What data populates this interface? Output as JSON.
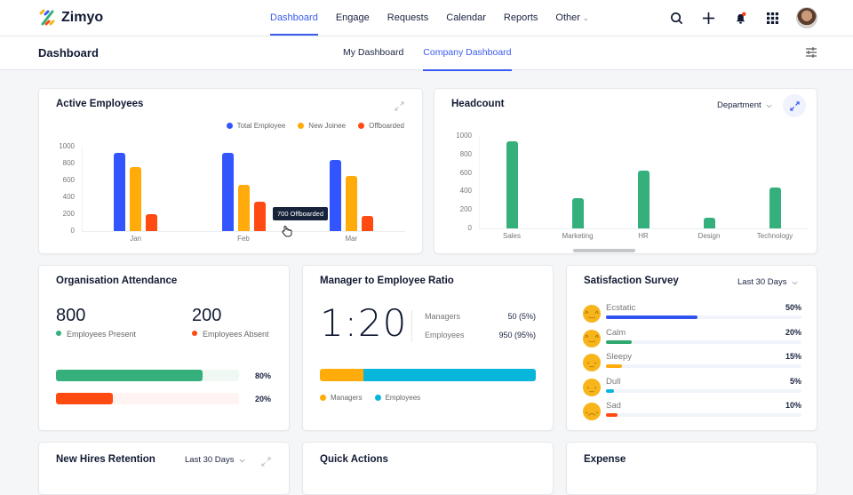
{
  "app": {
    "name": "Zimyo"
  },
  "nav": {
    "items": [
      {
        "label": "Dashboard",
        "active": true
      },
      {
        "label": "Engage"
      },
      {
        "label": "Requests"
      },
      {
        "label": "Calendar"
      },
      {
        "label": "Reports"
      },
      {
        "label": "Other",
        "has_dropdown": true
      }
    ],
    "icons": [
      "search-icon",
      "plus-icon",
      "bell-icon",
      "apps-grid-icon",
      "avatar"
    ]
  },
  "subheader": {
    "title": "Dashboard",
    "tabs": [
      {
        "label": "My Dashboard"
      },
      {
        "label": "Company Dashboard",
        "active": true
      }
    ]
  },
  "colors": {
    "accent": "#3a5bf0",
    "total_employee": "#3355ff",
    "new_joinee": "#ffab0a",
    "offboarded": "#ff4a12",
    "green": "#35b07c",
    "cyan": "#08b6dc"
  },
  "active_employees": {
    "title": "Active Employees",
    "tooltip": "700 Offboarded"
  },
  "headcount": {
    "title": "Headcount",
    "dropdown": "Department"
  },
  "chart_data": [
    {
      "type": "bar",
      "title": "Active Employees",
      "categories": [
        "Jan",
        "Feb",
        "Mar"
      ],
      "series": [
        {
          "name": "Total Employee",
          "values": [
            930,
            930,
            840
          ],
          "color": "#3355ff"
        },
        {
          "name": "New Joinee",
          "values": [
            760,
            545,
            650
          ],
          "color": "#ffab0a"
        },
        {
          "name": "Offboarded",
          "values": [
            200,
            350,
            175
          ],
          "color": "#ff4a12"
        }
      ],
      "yticks": [
        "0",
        "200",
        "400",
        "600",
        "800",
        "1000"
      ],
      "ylim": [
        0,
        1000
      ],
      "legend": "top-right",
      "xlabel": "",
      "ylabel": ""
    },
    {
      "type": "bar",
      "title": "Headcount",
      "categories": [
        "Sales",
        "Marketing",
        "HR",
        "Design",
        "Technology"
      ],
      "values": [
        942,
        327,
        622,
        112,
        445
      ],
      "color": "#35b07c",
      "yticks": [
        "0",
        "200",
        "400",
        "600",
        "800",
        "1000"
      ],
      "ylim": [
        0,
        1000
      ],
      "xlabel": "",
      "ylabel": ""
    }
  ],
  "attendance": {
    "title": "Organisation Attendance",
    "present_value": "800",
    "present_label": "Employees Present",
    "absent_value": "200",
    "absent_label": "Employees Absent",
    "present_pct": "80%",
    "absent_pct": "20%",
    "present_fill": 0.8,
    "absent_fill": 0.31
  },
  "ratio": {
    "title": "Manager to Employee Ratio",
    "value": "1:20",
    "managers_label": "Managers",
    "managers_value": "50 (5%)",
    "employees_label": "Employees",
    "employees_value": "950 (95%)",
    "managers_bar_fraction": 0.2,
    "legend": [
      "Managers",
      "Employees"
    ]
  },
  "survey": {
    "title": "Satisfaction Survey",
    "dropdown": "Last 30 Days",
    "items": [
      {
        "label": "Ecstatic",
        "pct": "50%",
        "fill": 0.47,
        "color": "#2f52f0",
        "face": "^‿^"
      },
      {
        "label": "Calm",
        "pct": "20%",
        "fill": 0.13,
        "color": "#2fa86e",
        "face": "^‿^"
      },
      {
        "label": "Sleepy",
        "pct": "15%",
        "fill": 0.08,
        "color": "#ffab0a",
        "face": "-_-"
      },
      {
        "label": "Dull",
        "pct": "5%",
        "fill": 0.04,
        "color": "#08b6dc",
        "face": "-_-"
      },
      {
        "label": "Sad",
        "pct": "10%",
        "fill": 0.06,
        "color": "#ff4a12",
        "face": "-︵-"
      }
    ]
  },
  "bottom_cards": {
    "retention": {
      "title": "New Hires Retention",
      "dropdown": "Last 30 Days"
    },
    "quick_actions": {
      "title": "Quick Actions"
    },
    "expense": {
      "title": "Expense"
    }
  }
}
